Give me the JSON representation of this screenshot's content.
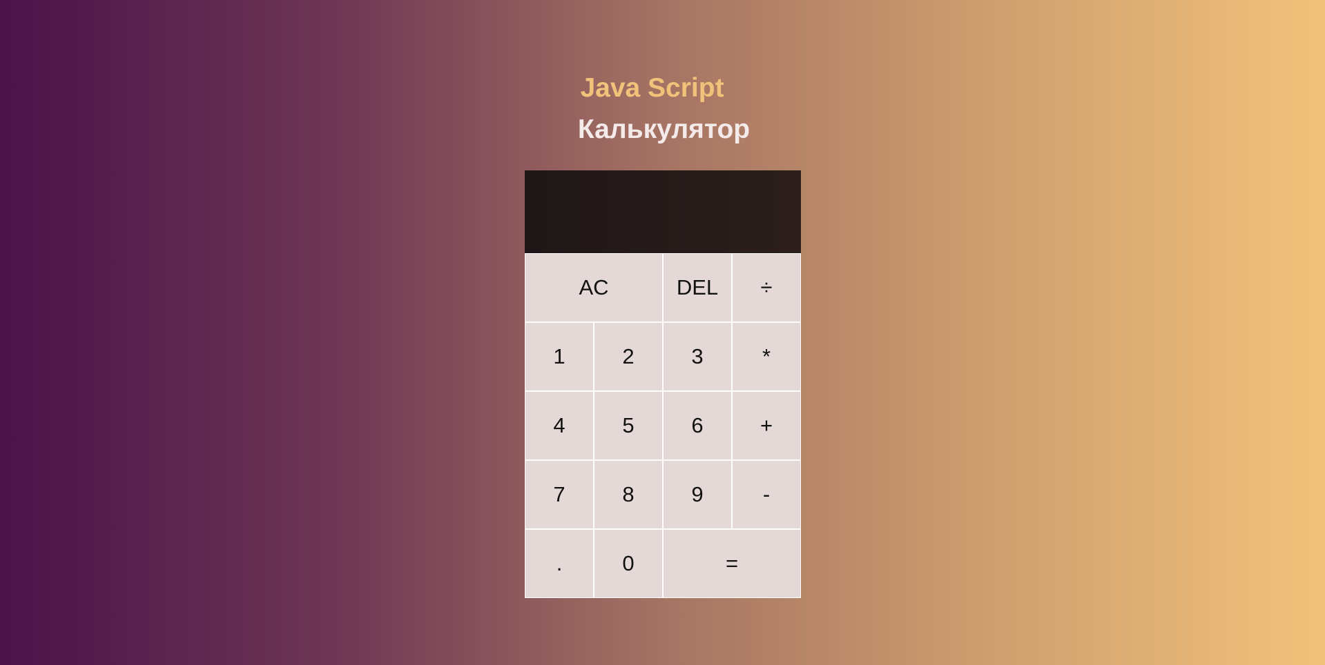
{
  "header": {
    "title": "Java Script",
    "subtitle": "Калькулятор"
  },
  "display": {
    "previous_operand": "",
    "current_operand": ""
  },
  "keys": {
    "all_clear": "AC",
    "delete": "DEL",
    "divide": "÷",
    "one": "1",
    "two": "2",
    "three": "3",
    "multiply": "*",
    "four": "4",
    "five": "5",
    "six": "6",
    "add": "+",
    "seven": "7",
    "eight": "8",
    "nine": "9",
    "subtract": "-",
    "decimal": ".",
    "zero": "0",
    "equals": "="
  },
  "colors": {
    "background_start": "#4a1249",
    "background_end": "#f1c27a",
    "title_color": "#f1c27a",
    "subtitle_color": "#f4eaea",
    "display_background": "#241a19",
    "key_background": "#e4d9d7"
  }
}
